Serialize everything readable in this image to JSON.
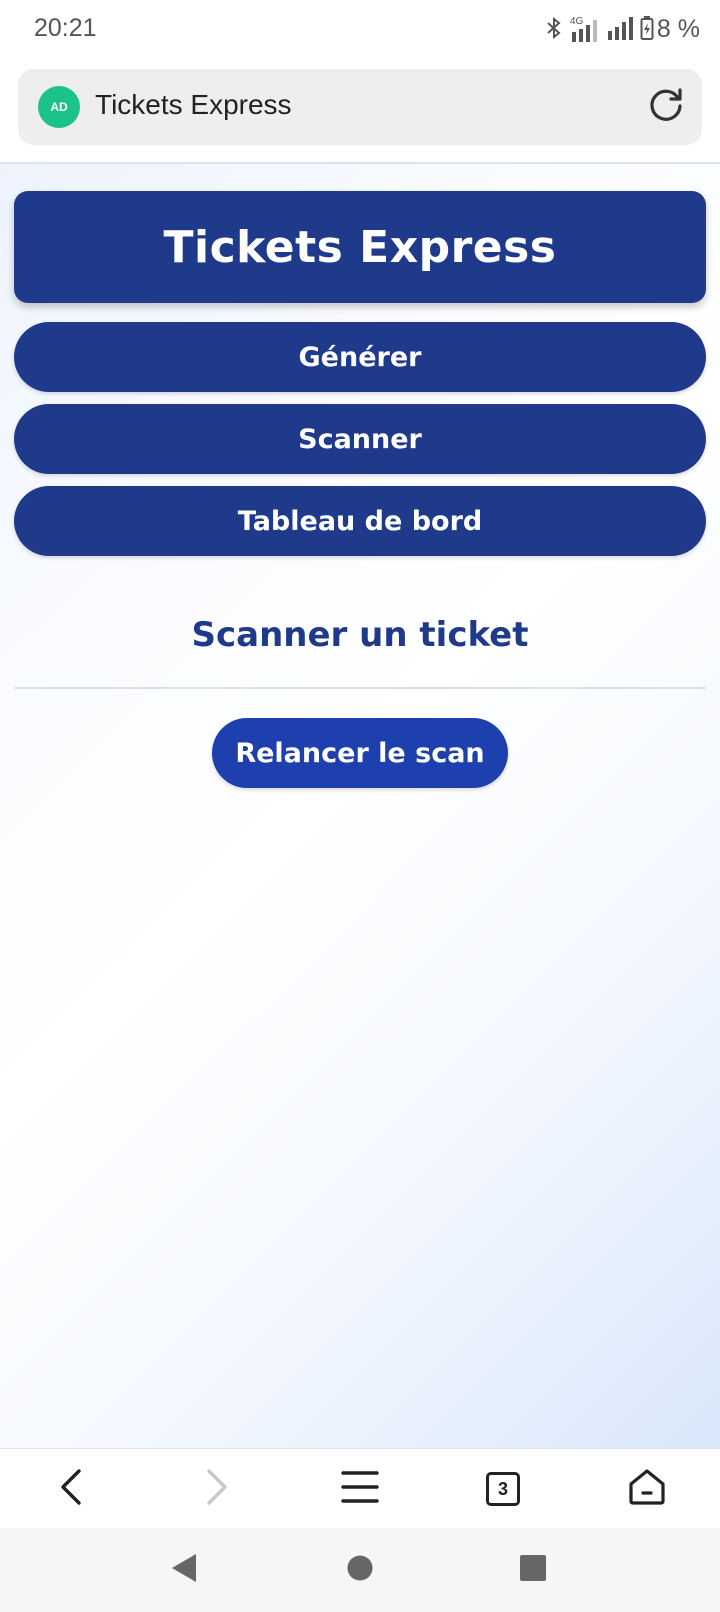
{
  "status_bar": {
    "time": "20:21",
    "network_label": "4G",
    "battery_text": "8 %",
    "icons": [
      "bluetooth-icon",
      "signal-4g-icon",
      "signal-icon",
      "battery-charging-icon"
    ]
  },
  "browser": {
    "address_text": "Tickets Express",
    "site_badge": "AD",
    "tab_count": "3",
    "icons": [
      "shield-icon",
      "reload-icon",
      "back-icon",
      "forward-icon",
      "menu-icon",
      "tabs-icon",
      "home-icon"
    ]
  },
  "app": {
    "title": "Tickets Express",
    "nav": [
      {
        "label": "Générer"
      },
      {
        "label": "Scanner"
      },
      {
        "label": "Tableau de bord"
      }
    ],
    "section_title": "Scanner un ticket",
    "rescan_label": "Relancer le scan"
  },
  "colors": {
    "primary": "#1f3a8a",
    "button_accent": "#1e40af",
    "shield_green": "#1bc28a"
  }
}
